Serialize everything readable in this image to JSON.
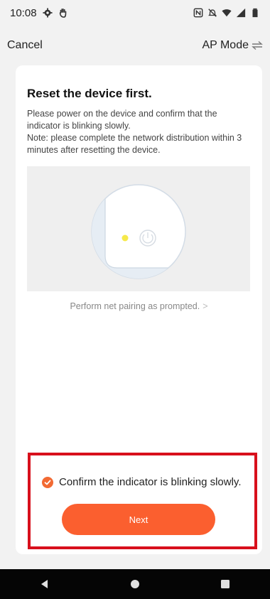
{
  "status_bar": {
    "time": "10:08",
    "icons_left": [
      "settings-icon",
      "hand-icon"
    ],
    "icons_right": [
      "nfc-icon",
      "mute-icon",
      "wifi-icon",
      "signal-icon",
      "battery-icon"
    ]
  },
  "nav": {
    "cancel_label": "Cancel",
    "mode_label": "AP Mode",
    "mode_icon": "swap-icon"
  },
  "card": {
    "title": "Reset the device first.",
    "description_lines": [
      "Please power on the device and confirm that the",
      "indicator is blinking slowly.",
      "Note: please complete the network distribution within 3",
      "minutes after resetting the device."
    ],
    "prompt_link": "Perform net pairing as prompted.",
    "prompt_chevron": ">"
  },
  "confirm": {
    "checked": true,
    "label": "Confirm the indicator is blinking slowly."
  },
  "next_label": "Next",
  "colors": {
    "accent": "#fb5f2f",
    "highlight": "#d8101c",
    "indicator": "#f6e94a",
    "background": "#f2f2f2"
  }
}
